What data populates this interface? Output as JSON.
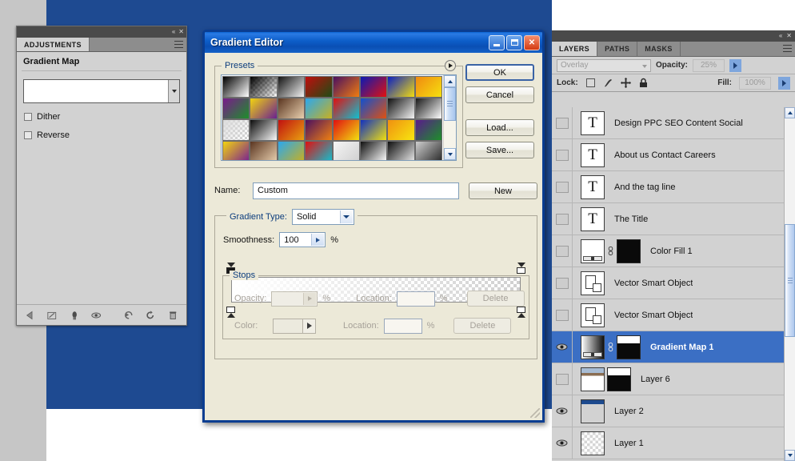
{
  "adjustments": {
    "tab_label": "ADJUSTMENTS",
    "title": "Gradient Map",
    "dither_label": "Dither",
    "reverse_label": "Reverse",
    "footer_icons": [
      "return-arrow-icon",
      "expand-view-icon",
      "clip-to-layer-icon",
      "toggle-visibility-icon",
      "reset-adjustment-icon",
      "revert-icon",
      "delete-icon"
    ],
    "dock_collapse": "«",
    "dock_close": "✕"
  },
  "gradient_editor": {
    "title": "Gradient Editor",
    "window_buttons": {
      "minimize": "minimize-button",
      "maximize": "maximize-button",
      "close": "close-button"
    },
    "presets": {
      "legend": "Presets",
      "swatches": [
        "linear-gradient(135deg,#000000,#ffffff)",
        "linear-gradient(135deg,#000000,rgba(255,255,255,0))",
        "linear-gradient(135deg,#141414,#f2f2f2)",
        "linear-gradient(135deg,#c10d0d,#1d4d14)",
        "linear-gradient(135deg,#4a1060,#f07c10)",
        "linear-gradient(135deg,#0a1ab4,#e21010)",
        "linear-gradient(135deg,#0b20c2,#f2dc10)",
        "linear-gradient(135deg,#f08a10,#f5e010)",
        "linear-gradient(135deg,#7a1a8c,#1d8f2a)",
        "linear-gradient(135deg,#f2d410,#6a2090)",
        "linear-gradient(135deg,#5a3520,#e8cfae)",
        "linear-gradient(135deg,#2aa8ef,#c8b020)",
        "linear-gradient(135deg,#e01010,#10c0d0)",
        "linear-gradient(135deg,#1050d0,#e05010)",
        "linear-gradient(135deg,#111111,#f4f4f4)",
        "linear-gradient(135deg,#1a1a1a,#ffffff)",
        "linear-gradient(135deg,#dcdcdc,rgba(0,0,0,0))",
        "linear-gradient(135deg,#0c0c0c,#fafafa)",
        "linear-gradient(135deg,#c01010,#e8a010)",
        "linear-gradient(135deg,#4a1060,#f08010)",
        "linear-gradient(135deg,#e01010,#f2e010)",
        "linear-gradient(135deg,#1030c0,#f0e010)",
        "linear-gradient(135deg,#f09010,#f7e610)",
        "linear-gradient(135deg,#5a1a8c,#1d8f2a)",
        "linear-gradient(135deg,#f2d410,#7a2090)",
        "linear-gradient(135deg,#5a3520,#e8cfae)",
        "linear-gradient(135deg,#2aa8ef,#c8b020)",
        "linear-gradient(135deg,#e01010,#10c0d0)",
        "linear-gradient(135deg,#f5f5f5,#d0d0d0)",
        "linear-gradient(135deg,#101010,#ffffff)",
        "linear-gradient(135deg,#0f0f0f,#e8e8e8)",
        "linear-gradient(135deg,#cfcfcf,#2a2a2a)"
      ],
      "expand_arrow": "presets-menu-arrow-icon"
    },
    "buttons": {
      "ok": "OK",
      "cancel": "Cancel",
      "load": "Load...",
      "save": "Save...",
      "new": "New"
    },
    "name": {
      "label": "Name:",
      "value": "Custom"
    },
    "gradient_type": {
      "label": "Gradient Type:",
      "value": "Solid"
    },
    "smoothness": {
      "label": "Smoothness:",
      "value": "100",
      "unit": "%"
    },
    "gradient_bar": {
      "top_stops": [
        {
          "position_pct": 0,
          "color": "#181818"
        },
        {
          "position_pct": 100,
          "color": "#ffffff"
        }
      ],
      "bottom_stops": [
        {
          "position_pct": 0,
          "color": "#ffffff"
        },
        {
          "position_pct": 100,
          "color": "#ffffff"
        }
      ]
    },
    "stops": {
      "legend": "Stops",
      "opacity_label": "Opacity:",
      "opacity_value": "",
      "opacity_unit": "%",
      "color_label": "Color:",
      "location_label_1": "Location:",
      "location_value_1": "",
      "location_unit_1": "%",
      "location_label_2": "Location:",
      "location_value_2": "",
      "location_unit_2": "%",
      "delete_label_1": "Delete",
      "delete_label_2": "Delete"
    }
  },
  "layers_panel": {
    "dock_collapse": "«",
    "dock_close": "✕",
    "tabs": [
      {
        "label": "LAYERS",
        "active": true
      },
      {
        "label": "PATHS",
        "active": false
      },
      {
        "label": "MASKS",
        "active": false
      }
    ],
    "blend_mode": "Overlay",
    "opacity_label": "Opacity:",
    "opacity_value": "25%",
    "lock_label": "Lock:",
    "lock_icons": [
      "lock-transparent-pixels-icon",
      "lock-image-pixels-icon",
      "lock-position-icon",
      "lock-all-icon"
    ],
    "fill_label": "Fill:",
    "fill_value": "100%",
    "layers": [
      {
        "name": "Design PPC SEO Content Social",
        "type": "text",
        "visible": false,
        "selected": false
      },
      {
        "name": "About us Contact Careers",
        "type": "text",
        "visible": false,
        "selected": false
      },
      {
        "name": "And the tag line",
        "type": "text",
        "visible": false,
        "selected": false
      },
      {
        "name": "The Title",
        "type": "text",
        "visible": false,
        "selected": false
      },
      {
        "name": "Color Fill 1",
        "type": "fill",
        "visible": false,
        "selected": false
      },
      {
        "name": "Vector Smart Object",
        "type": "smart",
        "visible": false,
        "selected": false
      },
      {
        "name": "Vector Smart Object",
        "type": "smart",
        "visible": false,
        "selected": false
      },
      {
        "name": "Gradient Map 1",
        "type": "gradient-map",
        "visible": true,
        "selected": true
      },
      {
        "name": "Layer 6",
        "type": "raster-mask",
        "visible": false,
        "selected": false
      },
      {
        "name": "Layer 2",
        "type": "raster",
        "visible": true,
        "selected": false
      },
      {
        "name": "Layer 1",
        "type": "raster",
        "visible": true,
        "selected": false
      }
    ]
  },
  "colors": {
    "canvas_blue": "#1e4a91",
    "selection_blue": "#3b6fc4",
    "titlebar_blue": "#0d5ec9",
    "panel_gray": "#d2d2d2",
    "dialog_face": "#ece9d8"
  }
}
